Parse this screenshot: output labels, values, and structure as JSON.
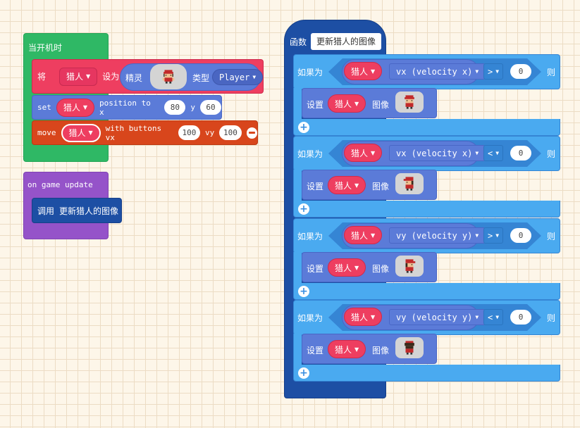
{
  "on_start": {
    "label": "当开机时"
  },
  "set_kind": {
    "label_set": "将",
    "variable": "猎人",
    "label_to": "设为",
    "sprite_label": "精灵",
    "kind_label": "类型",
    "kind_value": "Player"
  },
  "set_position": {
    "label_set": "set",
    "variable": "猎人",
    "label_pos": "position to x",
    "x": "80",
    "label_y": "y",
    "y": "60"
  },
  "move": {
    "label_move": "move",
    "variable": "猎人",
    "label_with": "with buttons vx",
    "vx": "100",
    "label_vy": "vy",
    "vy": "100"
  },
  "on_update": {
    "label": "on game update",
    "call_label": "调用",
    "call_name": "更新猎人的图像"
  },
  "function": {
    "label": "函数",
    "name": "更新猎人的图像",
    "ifs": [
      {
        "if_label": "如果为",
        "variable": "猎人",
        "property": "vx (velocity x)",
        "operator": ">",
        "value": "0",
        "then_label": "则",
        "set_label": "设置",
        "set_variable": "猎人",
        "image_label": "图像",
        "sprite_dir": "up"
      },
      {
        "if_label": "如果为",
        "variable": "猎人",
        "property": "vx (velocity x)",
        "operator": "<",
        "value": "0",
        "then_label": "则",
        "set_label": "设置",
        "set_variable": "猎人",
        "image_label": "图像",
        "sprite_dir": "left"
      },
      {
        "if_label": "如果为",
        "variable": "猎人",
        "property": "vy (velocity y)",
        "operator": ">",
        "value": "0",
        "then_label": "则",
        "set_label": "设置",
        "set_variable": "猎人",
        "image_label": "图像",
        "sprite_dir": "right"
      },
      {
        "if_label": "如果为",
        "variable": "猎人",
        "property": "vy (velocity y)",
        "operator": "<",
        "value": "0",
        "then_label": "则",
        "set_label": "设置",
        "set_variable": "猎人",
        "image_label": "图像",
        "sprite_dir": "down"
      }
    ]
  },
  "colors": {
    "loops": "#2fb865",
    "sprites": "#ee3e60",
    "controller": "#d8461c",
    "game": "#9553c9",
    "functions": "#1d4fa4",
    "logic": "#4aaaf0",
    "logic_dark": "#3585d4",
    "variables": "#e83060",
    "math": "#5b7bd8"
  }
}
